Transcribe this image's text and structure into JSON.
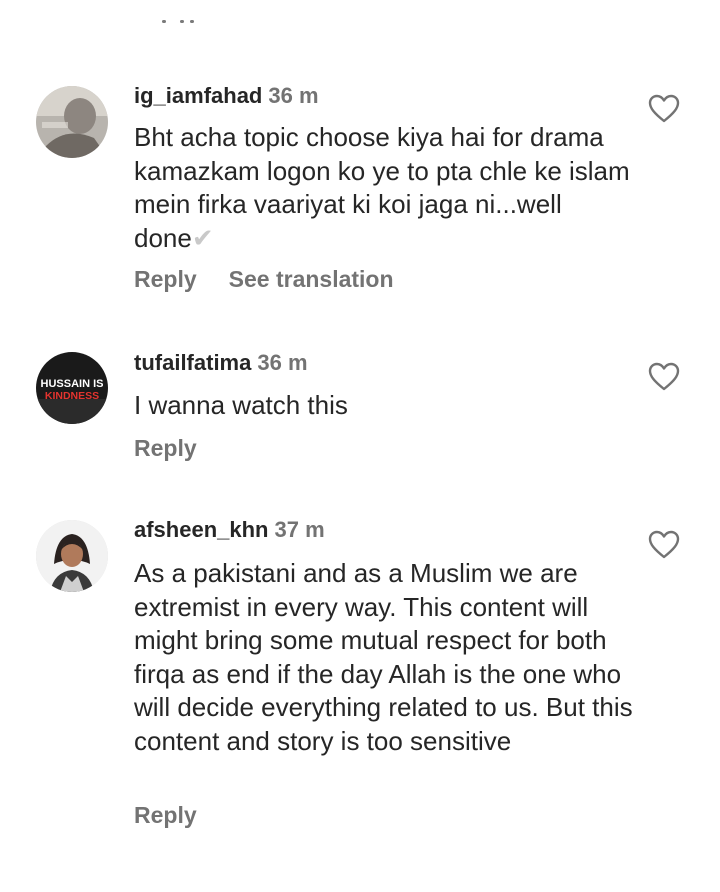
{
  "comments": [
    {
      "username": "ig_iamfahad",
      "time": "36 m",
      "text": "Bht acha topic choose kiya hai for drama kamazkam logon ko ye to pta chle ke islam mein firka vaariyat ki koi jaga ni...well done",
      "emoji": "✔",
      "reply_label": "Reply",
      "translation_label": "See translation"
    },
    {
      "username": "tufailfatima",
      "time": "36 m",
      "text": "I wanna watch this",
      "reply_label": "Reply",
      "avatar_text_top": "HUSSAIN IS",
      "avatar_text_bottom": "KINDNESS"
    },
    {
      "username": "afsheen_khn",
      "time": "37 m",
      "text": "As a pakistani and as a Muslim we are extremist in every way. This content will might bring some mutual respect for both firqa as end if the day Allah is the one who will decide everything related to us. But this content and story is too sensitive",
      "reply_label": "Reply"
    }
  ],
  "icons": {
    "like": "heart-outline-icon"
  },
  "colors": {
    "text_primary": "#262626",
    "text_secondary": "#737373",
    "avatar_ring": "#dbdbdb",
    "avatar2_bg": "#1a1a1a",
    "avatar2_accent": "#e3342f"
  }
}
